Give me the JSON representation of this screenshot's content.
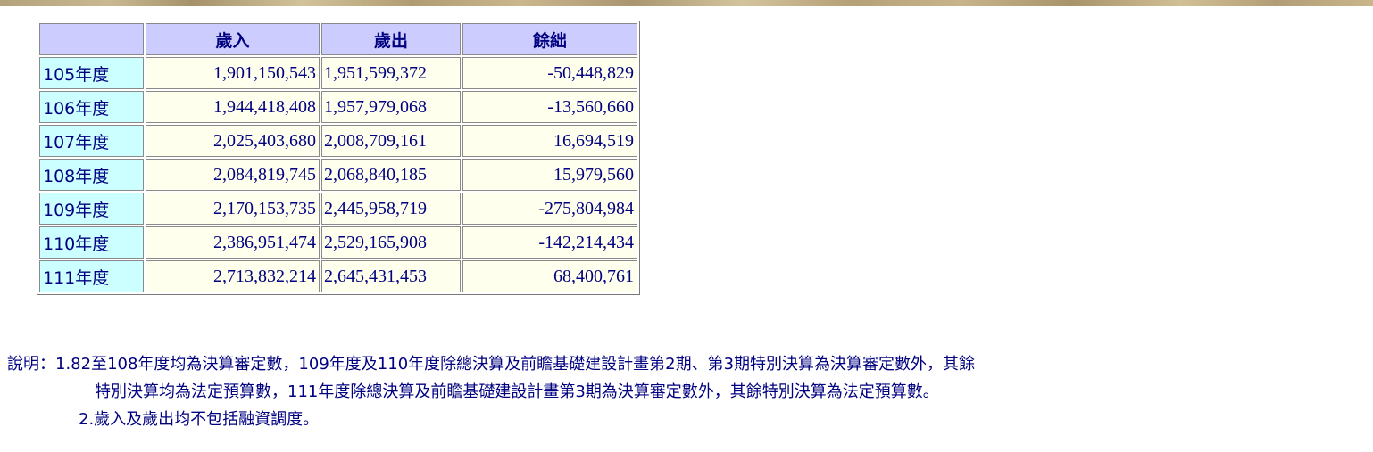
{
  "table": {
    "headers": [
      "",
      "歲入",
      "歲出",
      "餘絀"
    ],
    "rows": [
      {
        "year": "105年度",
        "revenue": "1,901,150,543",
        "expenditure": "1,951,599,372",
        "balance": "-50,448,829"
      },
      {
        "year": "106年度",
        "revenue": "1,944,418,408",
        "expenditure": "1,957,979,068",
        "balance": "-13,560,660"
      },
      {
        "year": "107年度",
        "revenue": "2,025,403,680",
        "expenditure": "2,008,709,161",
        "balance": "16,694,519"
      },
      {
        "year": "108年度",
        "revenue": "2,084,819,745",
        "expenditure": "2,068,840,185",
        "balance": "15,979,560"
      },
      {
        "year": "109年度",
        "revenue": "2,170,153,735",
        "expenditure": "2,445,958,719",
        "balance": "-275,804,984"
      },
      {
        "year": "110年度",
        "revenue": "2,386,951,474",
        "expenditure": "2,529,165,908",
        "balance": "-142,214,434"
      },
      {
        "year": "111年度",
        "revenue": "2,713,832,214",
        "expenditure": "2,645,431,453",
        "balance": "68,400,761"
      }
    ]
  },
  "notes": {
    "line1": "說明：1.82至108年度均為決算審定數，109年度及110年度除總決算及前瞻基礎建設計畫第2期、第3期特別決算為決算審定數外，其餘",
    "line2": "特別決算均為法定預算數，111年度除總決算及前瞻基礎建設計畫第3期為決算審定數外，其餘特別決算為法定預算數。",
    "line3": "2.歲入及歲出均不包括融資調度。"
  },
  "colors": {
    "header_bg": "#ccccff",
    "year_bg": "#ccffff",
    "value_bg": "#ffffee",
    "text": "#000080"
  }
}
